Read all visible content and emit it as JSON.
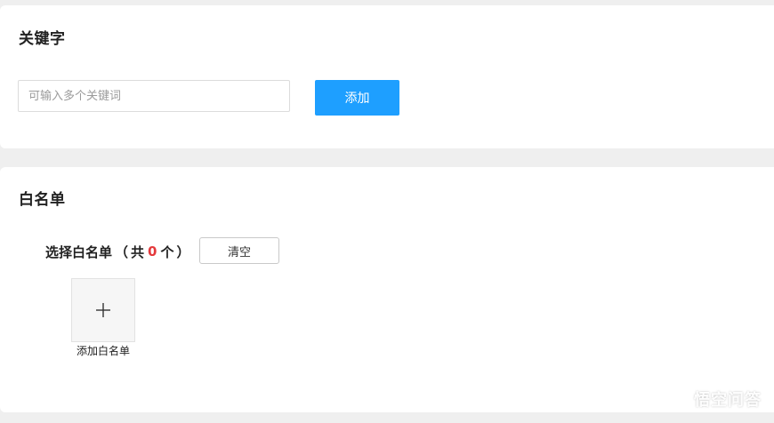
{
  "keywords": {
    "title": "关键字",
    "input": {
      "value": "",
      "placeholder": "可输入多个关键词"
    },
    "add_button": "添加",
    "accent": "#1e9fff"
  },
  "whitelist": {
    "title": "白名单",
    "select_label": "选择白名单",
    "open_paren": "（",
    "count_prefix": "共",
    "count": "0",
    "count_suffix": "个",
    "close_paren": "）",
    "count_color": "#e4393c",
    "clear_button": "清空",
    "add_tile_icon": "plus-icon",
    "add_tile_label": "添加白名单"
  },
  "watermark": {
    "text": "悟空问答",
    "icon": "chat-bubble-icon"
  }
}
